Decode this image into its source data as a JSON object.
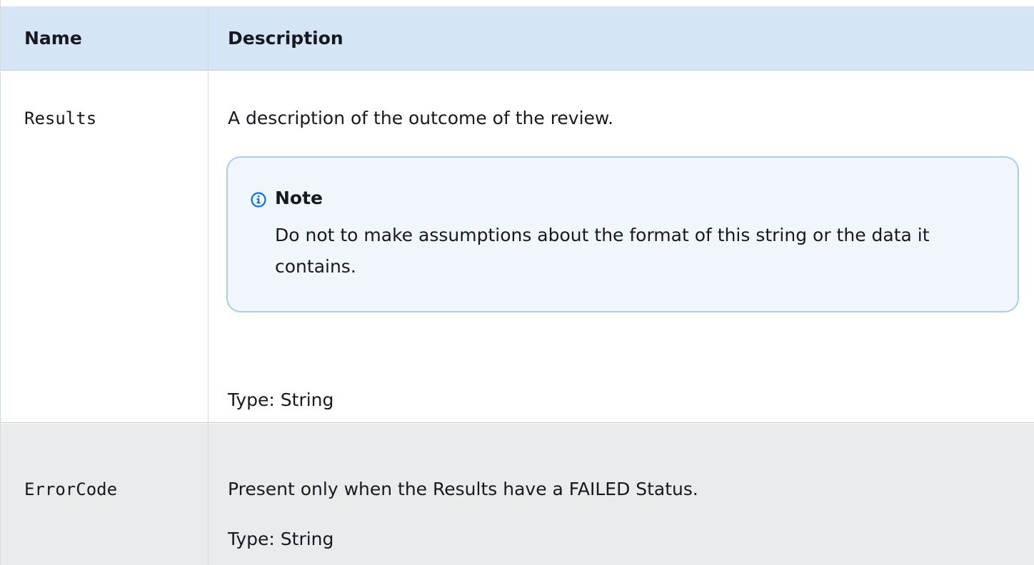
{
  "table": {
    "headers": {
      "name": "Name",
      "description": "Description"
    },
    "rows": [
      {
        "name": "Results",
        "description": "A description of the outcome of the review.",
        "note": {
          "title": "Note",
          "icon": "info-icon",
          "body": "Do not to make assumptions about the format  of this string or the data it contains."
        },
        "type": "Type: String"
      },
      {
        "name": "ErrorCode",
        "description": "Present only when the Results have a FAILED Status.",
        "type": "Type: String"
      }
    ]
  },
  "colors": {
    "header_bg": "#d5e5f6",
    "alt_row_bg": "#eaebed",
    "note_bg": "#f1f6fc",
    "note_border": "#a9cdec",
    "info_icon": "#0972d3"
  }
}
